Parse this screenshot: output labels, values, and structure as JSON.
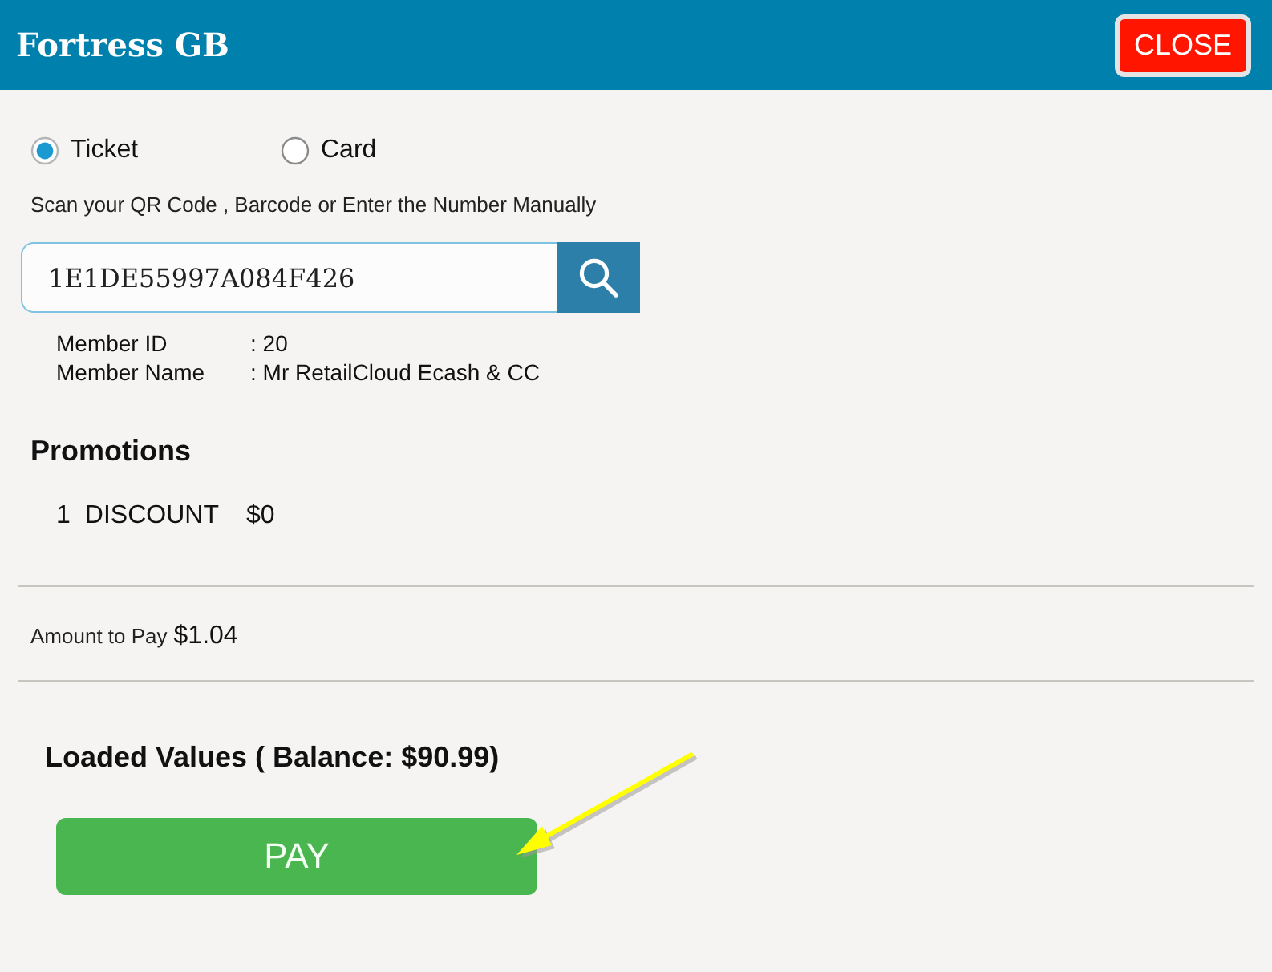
{
  "window": {
    "title": "Fortress GB",
    "close_button": "CLOSE"
  },
  "payment_modes": [
    {
      "label": "Ticket",
      "selected": true
    },
    {
      "label": "Card",
      "selected": false
    }
  ],
  "instruction": "Scan your QR Code , Barcode or Enter the Number Manually",
  "search": {
    "value": "1E1DE55997A084F426"
  },
  "member": [
    {
      "label": "Member ID",
      "value": ": 20"
    },
    {
      "label": "Member Name",
      "value": ": Mr RetailCloud Ecash & CC"
    }
  ],
  "promotions": {
    "heading": "Promotions",
    "items": [
      {
        "number": "1",
        "name": "DISCOUNT",
        "amount": "$0"
      }
    ]
  },
  "amount_to_pay": {
    "label": "Amount to Pay",
    "value": "$1.04"
  },
  "loaded_values": {
    "heading": "Loaded Values ( Balance: $90.99)",
    "button": "PAY"
  }
}
